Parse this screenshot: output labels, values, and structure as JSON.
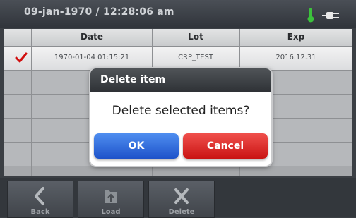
{
  "status": {
    "datetime": "09-jan-1970 / 12:28:06 am",
    "icons": [
      "thermometer-icon",
      "plug-icon"
    ]
  },
  "table": {
    "headers": [
      "Date",
      "Lot",
      "Exp"
    ],
    "rows": [
      {
        "selected": true,
        "date": "1970-01-04 01:15:21",
        "lot": "CRP_TEST",
        "exp": "2016.12.31"
      }
    ]
  },
  "dialog": {
    "title": "Delete item",
    "message": "Delete selected items?",
    "ok": "OK",
    "cancel": "Cancel"
  },
  "toolbar": {
    "back": "Back",
    "load": "Load",
    "delete": "Delete"
  },
  "colors": {
    "thermometer": "#3cc23c",
    "check": "#d10f0f",
    "ok": "#2d6be0",
    "cancel": "#e02525"
  }
}
